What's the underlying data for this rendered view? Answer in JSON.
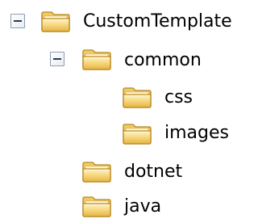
{
  "tree": {
    "root": {
      "label": "CustomTemplate",
      "expanded": true,
      "icon": "folder-open-icon"
    },
    "common": {
      "label": "common",
      "expanded": true,
      "icon": "folder-open-icon"
    },
    "css": {
      "label": "css",
      "icon": "folder-icon"
    },
    "images": {
      "label": "images",
      "icon": "folder-icon"
    },
    "dotnet": {
      "label": "dotnet",
      "icon": "folder-icon"
    },
    "java": {
      "label": "java",
      "icon": "folder-icon"
    }
  },
  "colors": {
    "folder_fill": "#f4d580",
    "folder_border": "#c79b2b",
    "expander_border": "#8f9db2"
  }
}
